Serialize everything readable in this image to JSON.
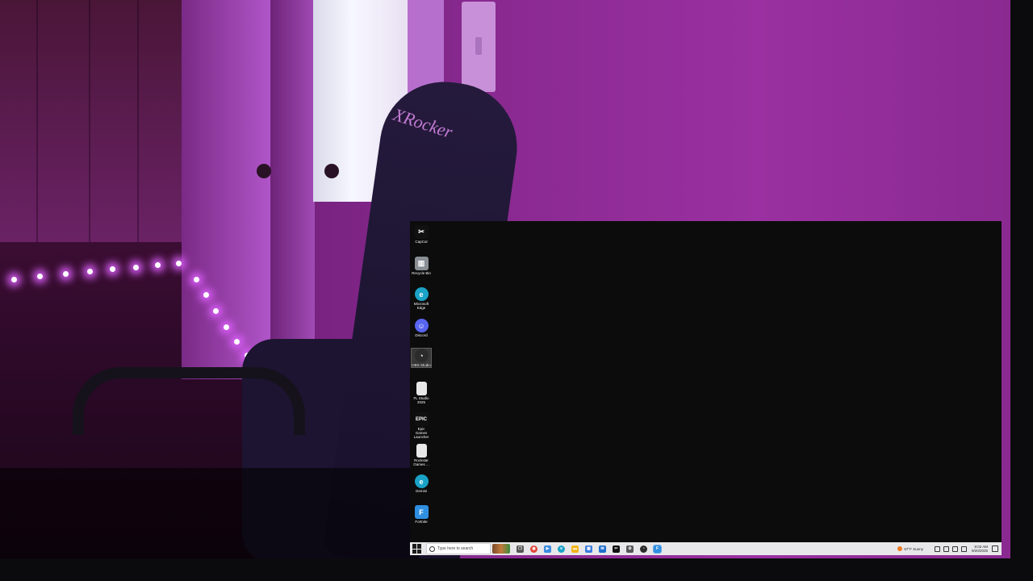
{
  "desktop_icons": [
    {
      "label": "CapCut",
      "icon": "capcut-icon",
      "color": "#111111",
      "glyph": "✂"
    },
    {
      "label": "Recycle Bin",
      "icon": "recycle-bin-icon",
      "color": "#8a8f96",
      "glyph": "▥"
    },
    {
      "label": "Microsoft Edge",
      "icon": "edge-icon",
      "color": "#1aa2c7",
      "glyph": "e"
    },
    {
      "label": "Discord",
      "icon": "discord-icon",
      "color": "#5865f2",
      "glyph": "☺"
    },
    {
      "label": "OBS Studio",
      "icon": "obs-icon",
      "color": "#2b2b2b",
      "glyph": "◔"
    },
    {
      "label": "FL Studio 2025",
      "icon": "file-icon",
      "color": "#e8e8e8",
      "glyph": ""
    },
    {
      "label": "Epic Games Launcher",
      "icon": "epic-games-icon",
      "color": "#101010",
      "glyph": "EPIC"
    },
    {
      "label": "Rockstar Games ...",
      "icon": "file-icon",
      "color": "#e8e8e8",
      "glyph": ""
    },
    {
      "label": "Gemini",
      "icon": "edge-icon",
      "color": "#1aa2c7",
      "glyph": "e"
    },
    {
      "label": "Fortnite",
      "icon": "fortnite-icon",
      "color": "#2f8fe0",
      "glyph": "F"
    }
  ],
  "taskbar": {
    "search_placeholder": "Type here to search",
    "apps": [
      {
        "icon": "task-view-icon",
        "color": "#555555",
        "glyph": "❐"
      },
      {
        "icon": "chrome-icon",
        "color": "#e0463a",
        "glyph": "◉"
      },
      {
        "icon": "meet-icon",
        "color": "#3a8be0",
        "glyph": "▶"
      },
      {
        "icon": "edge-icon",
        "color": "#1aa2c7",
        "glyph": "e"
      },
      {
        "icon": "file-explorer-icon",
        "color": "#f2b51f",
        "glyph": "▬"
      },
      {
        "icon": "store-icon",
        "color": "#3a7be0",
        "glyph": "▦"
      },
      {
        "icon": "outlook-icon",
        "color": "#1f6fd0",
        "glyph": "✉"
      },
      {
        "icon": "capcut-icon",
        "color": "#111111",
        "glyph": "✂"
      },
      {
        "icon": "settings-icon",
        "color": "#555555",
        "glyph": "⚙"
      },
      {
        "icon": "obs-icon",
        "color": "#2b2b2b",
        "glyph": "◔"
      },
      {
        "icon": "fortnite-icon",
        "color": "#2f8fe0",
        "glyph": "F"
      }
    ],
    "weather": "67°F Sunny",
    "time": "8:02 AM",
    "date": "9/20/2025"
  },
  "camera": {
    "brand_text": "XRocker"
  }
}
